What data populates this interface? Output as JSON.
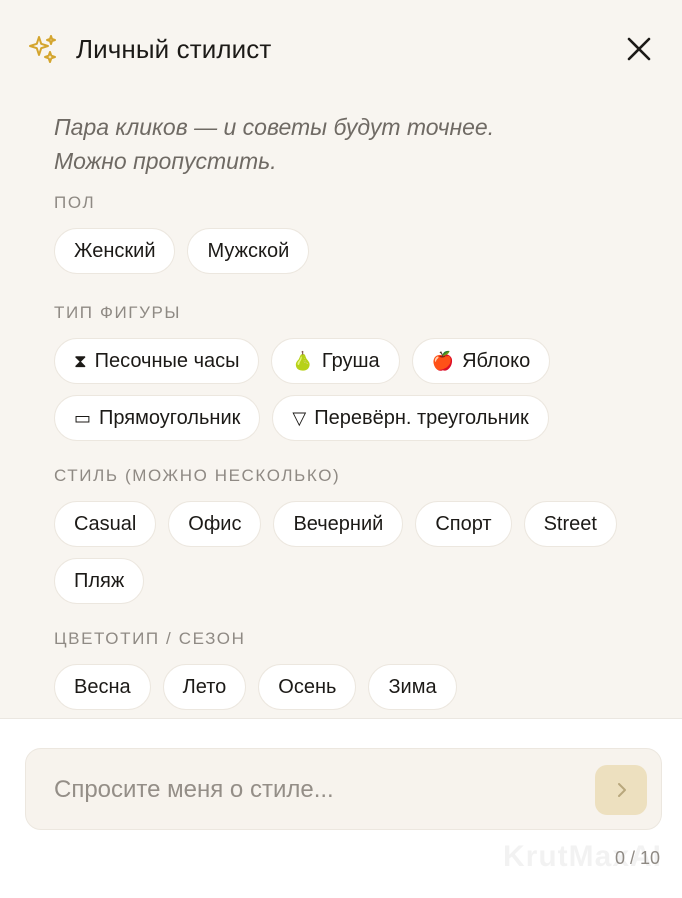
{
  "header": {
    "title": "Личный стилист",
    "icon": "sparkle-icon",
    "close_icon": "close-icon",
    "accent_color": "#d4a52e"
  },
  "intro": {
    "line1": "Пара кликов — и советы будут точнее.",
    "line2": "Можно пропустить."
  },
  "gender": {
    "label": "ПОЛ",
    "options": [
      "Женский",
      "Мужской"
    ]
  },
  "figure": {
    "label": "ТИП ФИГУРЫ",
    "options": [
      {
        "icon": "⧗",
        "label": "Песочные часы"
      },
      {
        "icon": "🍐",
        "label": "Груша"
      },
      {
        "icon": "🍎",
        "label": "Яблоко"
      },
      {
        "icon": "▭",
        "label": "Прямоугольник"
      },
      {
        "icon": "▽",
        "label": "Перевёрн. треугольник"
      }
    ]
  },
  "style": {
    "label": "СТИЛЬ (МОЖНО НЕСКОЛЬКО)",
    "options": [
      "Casual",
      "Офис",
      "Вечерний",
      "Спорт",
      "Street",
      "Пляж"
    ]
  },
  "season": {
    "label": "ЦВЕТОТИП / СЕЗОН",
    "options": [
      "Весна",
      "Лето",
      "Осень",
      "Зима"
    ]
  },
  "composer": {
    "placeholder": "Спросите меня о стиле...",
    "value": "",
    "send_icon": "chevron-right-icon",
    "counter": "0 / 10"
  },
  "watermark": "KrutMaxAI"
}
